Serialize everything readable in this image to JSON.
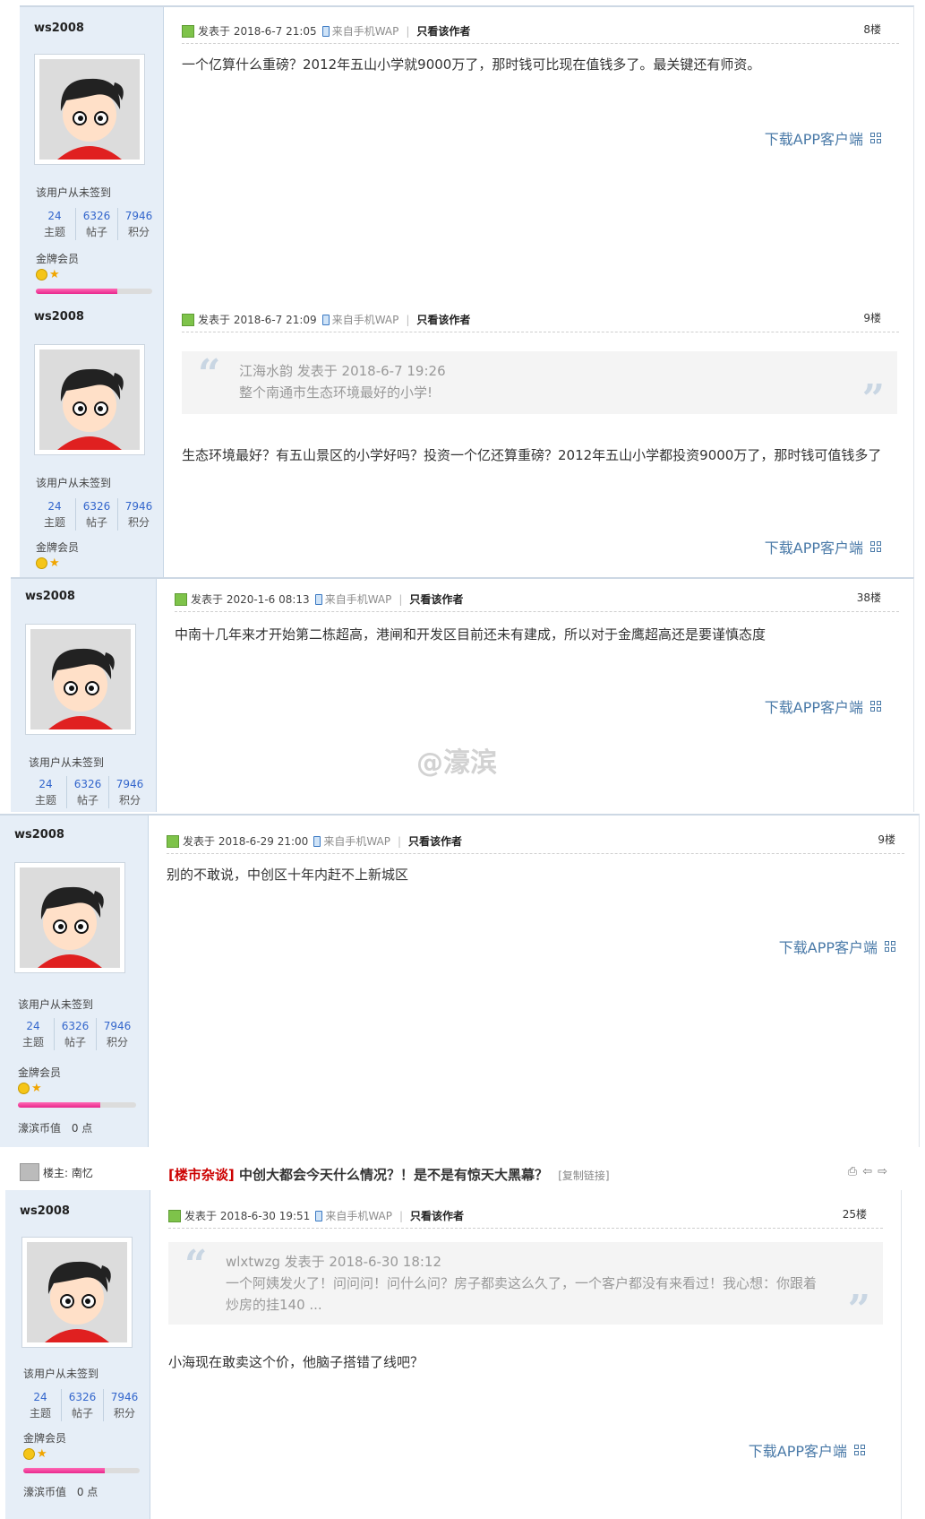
{
  "common": {
    "username": "ws2008",
    "signin_text": "该用户从未签到",
    "stats": [
      {
        "num": "24",
        "label": "主题"
      },
      {
        "num": "6326",
        "label": "帖子"
      },
      {
        "num": "7946",
        "label": "积分"
      }
    ],
    "member_level": "金牌会员",
    "currency_label": "濠滨币值",
    "currency_value": "0 点",
    "only_author": "只看该作者",
    "source": "来自手机WAP",
    "app_link": "下载APP客户端",
    "level_progress": 0.7
  },
  "posts": [
    {
      "posted": "发表于 2018-6-7 21:05",
      "floor": "8楼",
      "body": "一个亿算什么重磅？2012年五山小学就9000万了，那时钱可比现在值钱多了。最关键还有师资。"
    },
    {
      "posted": "发表于 2018-6-7 21:09",
      "floor": "9楼",
      "quote_author": "江海水韵 发表于 2018-6-7 19:26",
      "quote_text": "整个南通市生态环境最好的小学!",
      "body": "生态环境最好？有五山景区的小学好吗？投资一个亿还算重磅？2012年五山小学都投资9000万了，那时钱可值钱多了"
    },
    {
      "posted": "发表于 2020-1-6 08:13",
      "floor": "38楼",
      "body": "中南十几年来才开始第二栋超高，港闸和开发区目前还未有建成，所以对于金鹰超高还是要谨慎态度"
    },
    {
      "posted": "发表于 2018-6-29 21:00",
      "floor": "9楼",
      "body": "别的不敢说，中创区十年内赶不上新城区"
    },
    {
      "posted": "发表于 2018-6-30 19:51",
      "floor": "25楼",
      "quote_author": "wlxtwzg 发表于 2018-6-30 18:12",
      "quote_text": "一个阿姨发火了！问问问！问什么问？房子都卖这么久了，一个客户都没有来看过！我心想：你跟着炒房的挂140 ...",
      "body": "小海现在敢卖这个价，他脑子搭错了线吧？"
    }
  ],
  "thread": {
    "owner_label": "楼主: 南忆",
    "category": "[楼市杂谈]",
    "title": "中创大都会今天什么情况？！是不是有惊天大黑幕？",
    "copy_link": "[复制链接]"
  },
  "watermark": "@濠滨"
}
